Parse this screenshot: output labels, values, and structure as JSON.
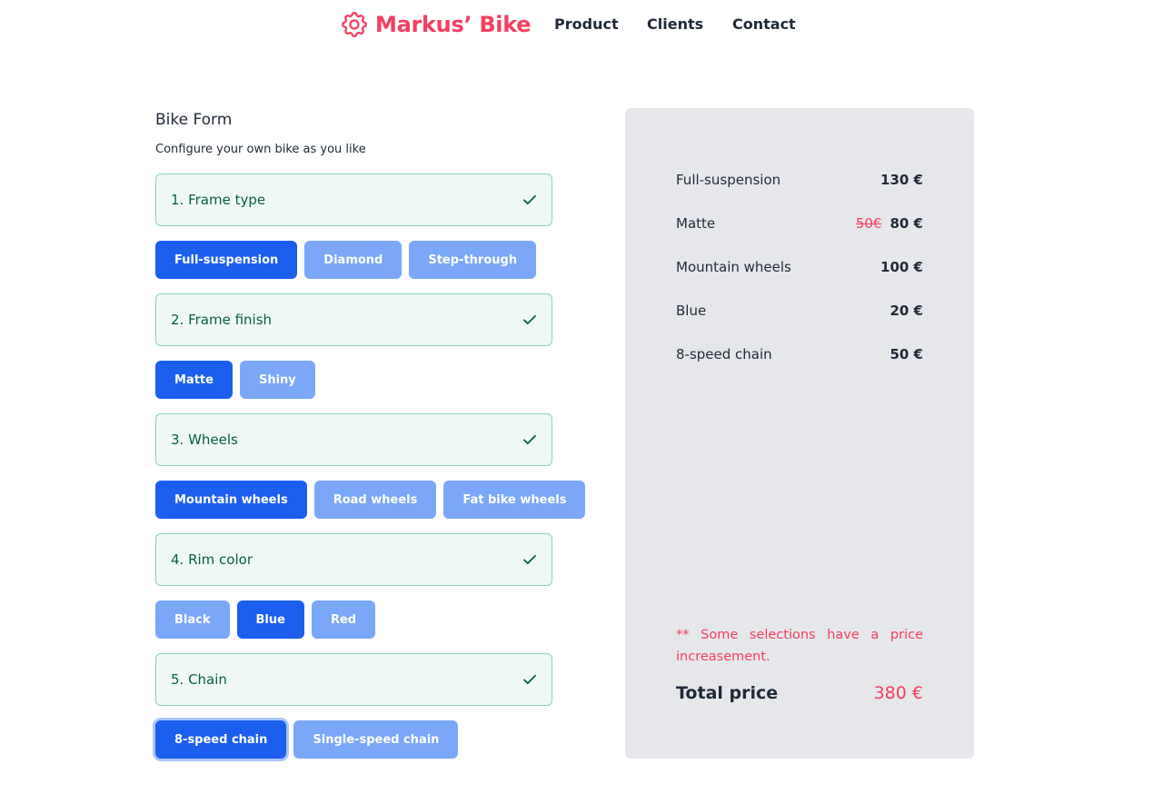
{
  "header": {
    "logo_text": "Markus’ Bike",
    "nav": [
      "Product",
      "Clients",
      "Contact"
    ]
  },
  "colors": {
    "brand": "#f43f5e",
    "primary": "#1c5fef",
    "primary_light": "#7aa7f8",
    "success": "#065f46",
    "success_border": "#86d5b2",
    "panel_bg": "#e5e7eb"
  },
  "form": {
    "title": "Bike Form",
    "subtitle": "Configure your own bike as you like",
    "steps": [
      {
        "title": "1. Frame type",
        "options": [
          "Full-suspension",
          "Diamond",
          "Step-through"
        ],
        "selected": "Full-suspension",
        "completed": true
      },
      {
        "title": "2. Frame finish",
        "options": [
          "Matte",
          "Shiny"
        ],
        "selected": "Matte",
        "completed": true
      },
      {
        "title": "3. Wheels",
        "options": [
          "Mountain wheels",
          "Road wheels",
          "Fat bike wheels"
        ],
        "selected": "Mountain wheels",
        "completed": true
      },
      {
        "title": "4. Rim color",
        "options": [
          "Black",
          "Blue",
          "Red"
        ],
        "selected": "Blue",
        "completed": true
      },
      {
        "title": "5. Chain",
        "options": [
          "8-speed chain",
          "Single-speed chain"
        ],
        "selected": "8-speed chain",
        "completed": true
      }
    ]
  },
  "summary": {
    "items": [
      {
        "label": "Full-suspension",
        "old_price": "",
        "price": "130 €"
      },
      {
        "label": "Matte",
        "old_price": "50€",
        "price": "80 €"
      },
      {
        "label": "Mountain wheels",
        "old_price": "",
        "price": "100 €"
      },
      {
        "label": "Blue",
        "old_price": "",
        "price": "20 €"
      },
      {
        "label": "8-speed chain",
        "old_price": "",
        "price": "50 €"
      }
    ],
    "note": "** Some selections have a price increasement.",
    "total_label": "Total price",
    "total_value": "380 €"
  }
}
